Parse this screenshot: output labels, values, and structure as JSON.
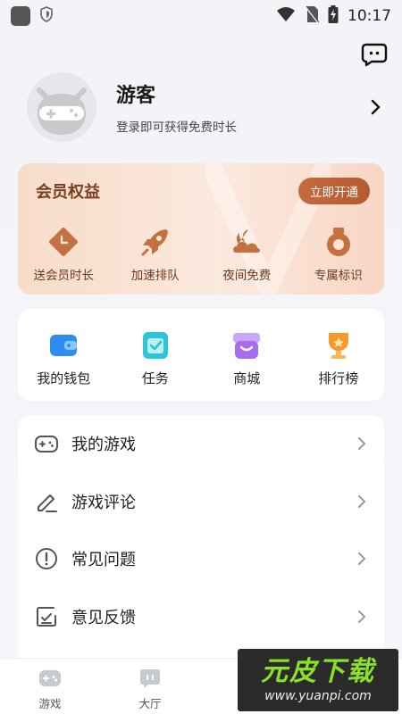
{
  "status_bar": {
    "time": "10:17"
  },
  "profile": {
    "username": "游客",
    "login_tip": "登录即可获得免费时长"
  },
  "vip": {
    "title": "会员权益",
    "button_label": "立即开通",
    "items": [
      {
        "label": "送会员时长",
        "icon": "clock-tag-icon"
      },
      {
        "label": "加速排队",
        "icon": "rocket-icon"
      },
      {
        "label": "夜间免费",
        "icon": "moon-cloud-icon"
      },
      {
        "label": "专属标识",
        "icon": "medal-icon"
      }
    ]
  },
  "tools": [
    {
      "label": "我的钱包",
      "icon": "wallet-icon"
    },
    {
      "label": "任务",
      "icon": "task-icon"
    },
    {
      "label": "商城",
      "icon": "store-icon"
    },
    {
      "label": "排行榜",
      "icon": "trophy-icon"
    }
  ],
  "menu": [
    {
      "label": "我的游戏",
      "icon": "gamepad-icon"
    },
    {
      "label": "游戏评论",
      "icon": "pencil-icon"
    },
    {
      "label": "常见问题",
      "icon": "exclamation-icon"
    },
    {
      "label": "意见反馈",
      "icon": "feedback-icon"
    }
  ],
  "tabs": [
    {
      "label": "游戏",
      "icon": "game-tab-icon"
    },
    {
      "label": "大厅",
      "icon": "hall-tab-icon"
    }
  ],
  "watermark": {
    "title": "元皮下载",
    "url": "www.yuanpi.com"
  },
  "colors": {
    "vip_accent": "#b45a30",
    "vip_text": "#7a3f1f",
    "tool_wallet": "#2f8cf0",
    "tool_task": "#2cc4d6",
    "tool_store": "#a76bf0",
    "tool_trophy": "#f39a2a"
  }
}
